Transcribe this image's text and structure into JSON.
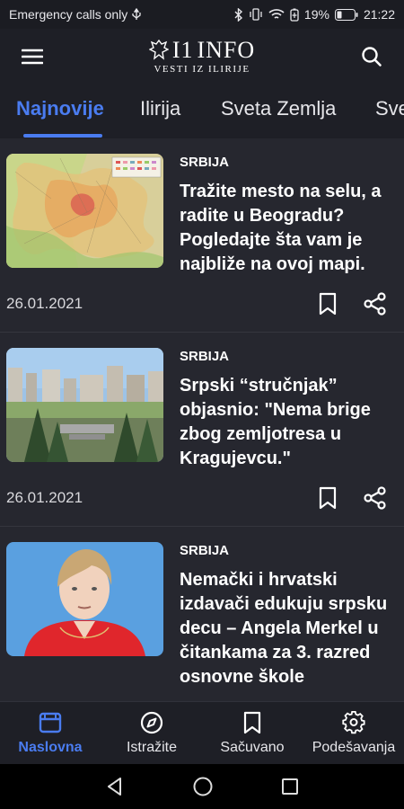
{
  "status_bar": {
    "carrier": "Emergency calls only",
    "battery": "19%",
    "time": "21:22"
  },
  "header": {
    "logo_line1": "INFO",
    "logo_mark": "I1",
    "logo_line2": "VESTI IZ ILIRIJE",
    "icons": [
      "menu-icon",
      "search-icon"
    ]
  },
  "tabs": [
    "Najnovije",
    "Ilirija",
    "Sveta Zemlja",
    "Sve"
  ],
  "active_tab": "Najnovije",
  "articles": [
    {
      "category": "SRBIJA",
      "title": "Tražite mesto na selu, a radite u Beogradu? Pogledajte šta vam je najbliže na ovoj mapi.",
      "date": "26.01.2021"
    },
    {
      "category": "SRBIJA",
      "title": "Srpski “stručnjak” objasnio: \"Nema brige zbog zemljotresa u Kragujevcu.\"",
      "date": "26.01.2021"
    },
    {
      "category": "SRBIJA",
      "title": "Nemački i hrvatski izdavači edukuju srpsku decu – Angela Merkel u čitankama za 3. razred osnovne škole",
      "date": ""
    }
  ],
  "bottom_nav": [
    {
      "label": "Naslovna",
      "icon": "news-icon",
      "active": true
    },
    {
      "label": "Istražite",
      "icon": "compass-icon",
      "active": false
    },
    {
      "label": "Sačuvano",
      "icon": "bookmark-icon",
      "active": false
    },
    {
      "label": "Podešavanja",
      "icon": "gear-icon",
      "active": false
    }
  ],
  "colors": {
    "accent": "#4a7cf0",
    "background": "#26272f",
    "bar": "#1e1f26"
  }
}
